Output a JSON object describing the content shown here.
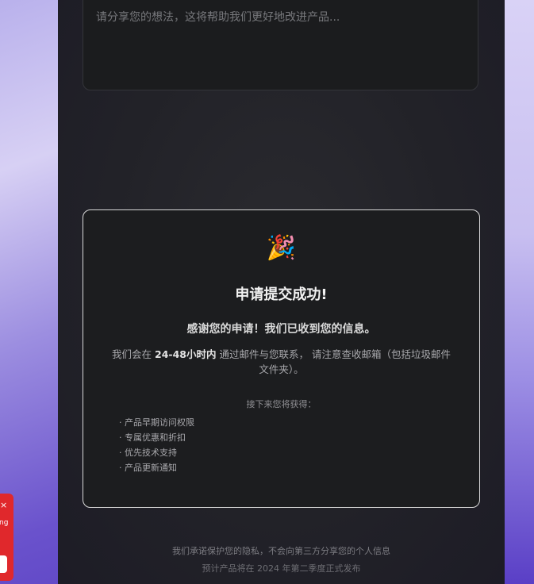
{
  "feedback": {
    "placeholder": "请分享您的想法，这将帮助我们更好地改进产品..."
  },
  "success": {
    "icon": "party-popper-icon",
    "icon_glyph": "🎉",
    "title": "申请提交成功!",
    "thanks": "感谢您的申请！我们已收到您的信息。",
    "contact_prefix": "我们会在 ",
    "contact_bold": "24-48小时内",
    "contact_suffix": " 通过邮件与您联系， 请注意查收邮箱（包括垃圾邮件文件夹）。",
    "next_title": "接下来您将获得：",
    "benefits": [
      "产品早期访问权限",
      "专属优惠和折扣",
      "优先技术支持",
      "产品更新通知"
    ]
  },
  "footer": {
    "privacy": "我们承诺保护您的隐私，不会向第三方分享您的个人信息",
    "release": "预计产品将在 2024 年第二季度正式发布"
  },
  "widget": {
    "close_glyph": "×",
    "partial_text": "ng",
    "color": "#e0282c"
  }
}
